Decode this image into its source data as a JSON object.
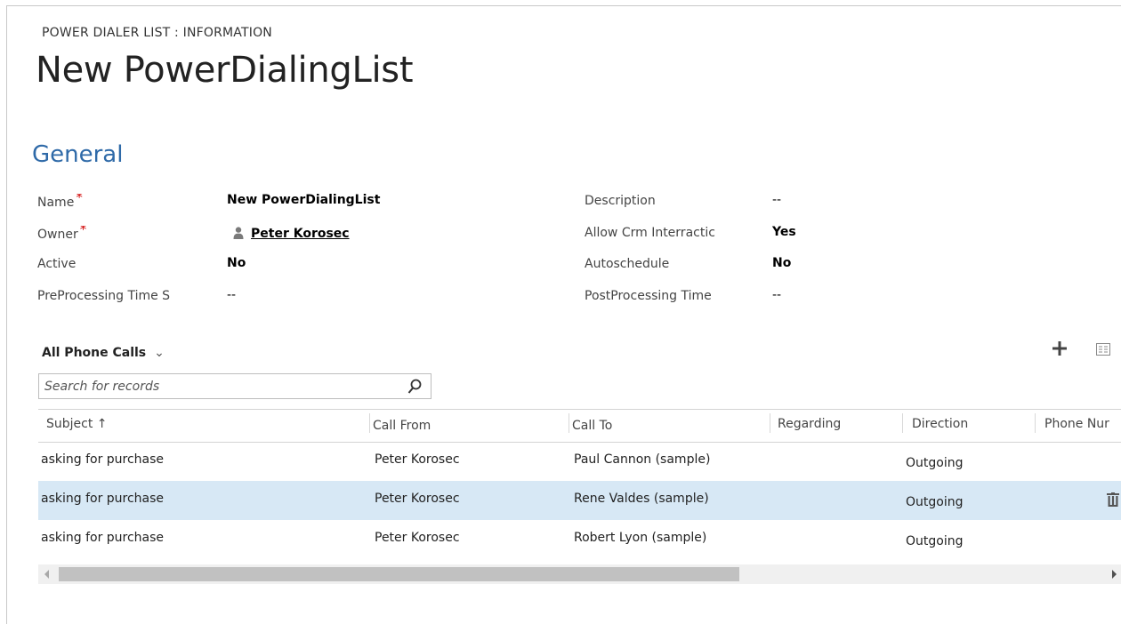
{
  "header": {
    "entity_type": "POWER DIALER LIST : INFORMATION",
    "title": "New PowerDialingList"
  },
  "section": {
    "title": "General"
  },
  "fields": {
    "name": {
      "label": "Name",
      "required": "*",
      "value": "New PowerDialingList"
    },
    "owner": {
      "label": "Owner",
      "required": "*",
      "value": "Peter Korosec",
      "icon": "person-icon"
    },
    "active": {
      "label": "Active",
      "value": "No"
    },
    "preprocessing": {
      "label": "PreProcessing Time S",
      "value": "--"
    },
    "description": {
      "label": "Description",
      "value": "--"
    },
    "allow_crm": {
      "label": "Allow Crm Interractic",
      "value": "Yes"
    },
    "autoschedule": {
      "label": "Autoschedule",
      "value": "No"
    },
    "postprocessing": {
      "label": "PostProcessing Time",
      "value": "--"
    }
  },
  "subgrid": {
    "view_name": "All Phone Calls",
    "view_chevron": "⌄",
    "search_placeholder": "Search for records",
    "icons": {
      "add": "plus-icon",
      "view": "grid-view-icon",
      "search": "search-icon",
      "delete": "trash-icon"
    },
    "columns": [
      "Subject ↑",
      "Call From",
      "Call To",
      "Regarding",
      "Direction",
      "Phone Nur"
    ],
    "rows": [
      {
        "subject": "asking for purchase",
        "call_from": "Peter Korosec",
        "call_to": "Paul Cannon (sample)",
        "regarding": "",
        "direction": "Outgoing",
        "phone": ""
      },
      {
        "subject": "asking for purchase",
        "call_from": "Peter Korosec",
        "call_to": "Rene Valdes (sample)",
        "regarding": "",
        "direction": "Outgoing",
        "phone": "",
        "selected": true
      },
      {
        "subject": "asking for purchase",
        "call_from": "Peter Korosec",
        "call_to": "Robert Lyon (sample)",
        "regarding": "",
        "direction": "Outgoing",
        "phone": ""
      }
    ]
  },
  "colors": {
    "section_title": "#2f6aa8",
    "required_marker": "#d00000",
    "selected_row": "#d7e8f5"
  }
}
